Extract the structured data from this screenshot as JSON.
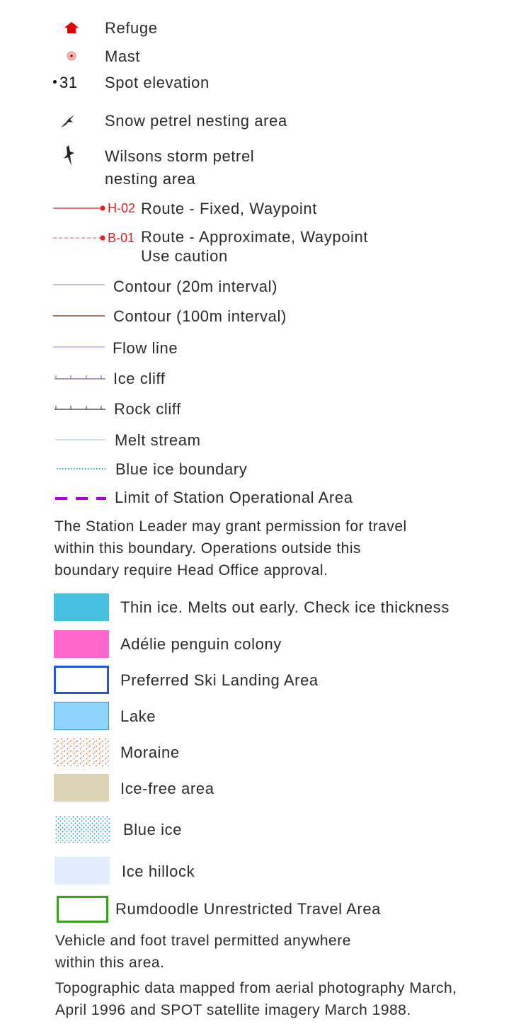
{
  "colors": {
    "refuge": "#e00000",
    "route": "#e02020",
    "thin_ice": "#47bfdf",
    "adelie": "#ff66cc",
    "ski_border": "#2456d6",
    "lake_fill": "#8fd6fc",
    "lake_border": "#3a8ecf",
    "moraine_dots": "#c05a2a",
    "ice_free": "#ddd3b5",
    "blue_ice_dots": "#1ea3c6",
    "ice_hillock": "#e3eefd",
    "rumdoodle_border": "#3ba020",
    "station_limit": "#b000e0"
  },
  "legend": {
    "refuge": {
      "icon": "house-icon",
      "label": "Refuge"
    },
    "mast": {
      "icon": "mast-icon",
      "label": "Mast"
    },
    "spot": {
      "value": "31",
      "label": "Spot elevation"
    },
    "snow_petrel": {
      "icon": "bird-icon",
      "label": "Snow petrel nesting area"
    },
    "wilsons": {
      "icon": "bird-icon",
      "label_line1": "Wilsons storm petrel",
      "label_line2": "nesting area"
    },
    "route_fixed": {
      "waypoint": "H-02",
      "label": "Route - Fixed, Waypoint"
    },
    "route_approx": {
      "waypoint": "B-01",
      "label_line1": "Route - Approximate, Waypoint",
      "label_line2": "Use caution"
    },
    "contour_20": {
      "label": "Contour (20m interval)"
    },
    "contour_100": {
      "label": "Contour (100m interval)"
    },
    "flow_line": {
      "label": "Flow line"
    },
    "ice_cliff": {
      "label": "Ice cliff"
    },
    "rock_cliff": {
      "label": "Rock cliff"
    },
    "melt_stream": {
      "label": "Melt stream"
    },
    "blue_ice_boundary": {
      "label": "Blue ice boundary"
    },
    "station_limit": {
      "label": "Limit of Station Operational Area"
    },
    "station_note": [
      "The Station Leader may grant permission for travel",
      "within this boundary. Operations outside this",
      "boundary require Head Office approval."
    ],
    "thin_ice": {
      "label": "Thin ice. Melts out early. Check ice thickness"
    },
    "adelie": {
      "label": "Adélie penguin colony"
    },
    "ski_landing": {
      "label": "Preferred Ski Landing Area"
    },
    "lake": {
      "label": "Lake"
    },
    "moraine": {
      "label": "Moraine"
    },
    "ice_free": {
      "label": "Ice-free area"
    },
    "blue_ice": {
      "label": "Blue ice"
    },
    "ice_hillock": {
      "label": "Ice hillock"
    },
    "rumdoodle": {
      "label": "Rumdoodle Unrestricted Travel Area"
    },
    "rumdoodle_note": [
      "Vehicle and foot travel permitted anywhere",
      "within this area."
    ],
    "source_note": [
      "Topographic data mapped from aerial photography March,",
      "April 1996 and SPOT satellite imagery March 1988."
    ]
  }
}
